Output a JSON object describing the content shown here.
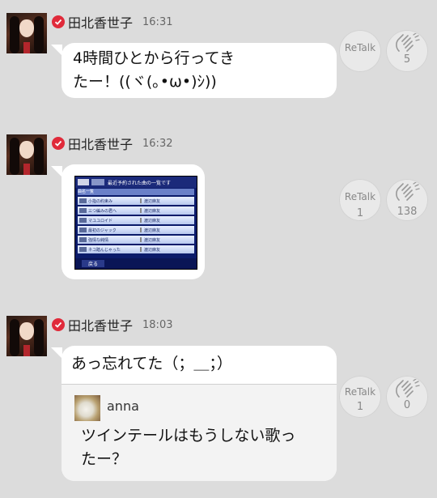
{
  "posts": [
    {
      "author": "田北香世子",
      "time": "16:31",
      "text_lines": [
        "4時間ひとから行ってき",
        "たー！((ヾ(｡•ω•)ｼ))"
      ],
      "retalk": {
        "label": "ReTalk",
        "count": ""
      },
      "claps": {
        "count": "5"
      }
    },
    {
      "author": "田北香世子",
      "time": "16:32",
      "image": {
        "title": "最近予約された曲の一覧です",
        "header": "曲名一覧",
        "rows": [
          {
            "song": "小指の約束み",
            "artist": "渡辺麻友"
          },
          {
            "song": "三つ編みの君へ",
            "artist": "渡辺麻友"
          },
          {
            "song": "マユユロイド",
            "artist": "渡辺麻友"
          },
          {
            "song": "最初のジャック",
            "artist": "渡辺麻友"
          },
          {
            "song": "強情な純情",
            "artist": "渡辺麻友"
          },
          {
            "song": "ネコ踏んじゃった",
            "artist": "渡辺麻友"
          }
        ],
        "back_label": "戻る"
      },
      "retalk": {
        "label": "ReTalk",
        "count": "1"
      },
      "claps": {
        "count": "138"
      }
    },
    {
      "author": "田北香世子",
      "time": "18:03",
      "text_lines": [
        "あっ忘れてた（；＿；）"
      ],
      "quote": {
        "author": "anna",
        "text_lines": [
          "ツインテールはもうしない歌っ",
          "たー？"
        ]
      },
      "retalk": {
        "label": "ReTalk",
        "count": "1"
      },
      "claps": {
        "count": "0"
      }
    }
  ],
  "colors": {
    "background": "#dcdcdc",
    "badge": "#e02a3a",
    "bubble": "#ffffff",
    "action_circle": "#e9e9e9"
  },
  "icons": {
    "badge": "check-badge-icon",
    "claps": "clap-hands-icon"
  }
}
